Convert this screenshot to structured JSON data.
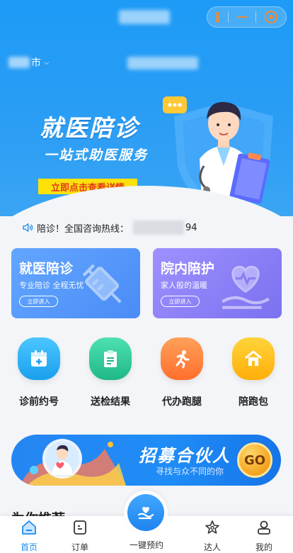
{
  "header": {
    "city_suffix": "市",
    "chevron": "⌵"
  },
  "banner": {
    "title": "就医陪诊",
    "subtitle": "一站式助医服务",
    "cta": "立即点击查看详情"
  },
  "notice": {
    "prefix": "陪诊！全国咨询热线：",
    "phone_tail": "94"
  },
  "cards": [
    {
      "title": "就医陪诊",
      "desc": "专业陪诊 全程无忧",
      "button": "立即进入"
    },
    {
      "title": "院内陪护",
      "desc": "家人般的温暖",
      "button": "立即进入"
    }
  ],
  "grid": [
    {
      "label": "诊前约号",
      "icon": "calendar-icon",
      "color": "#2bb3f3"
    },
    {
      "label": "送检结果",
      "icon": "clipboard-icon",
      "color": "#2fc99a"
    },
    {
      "label": "代办跑腿",
      "icon": "runner-icon",
      "color": "#ff8a3d"
    },
    {
      "label": "陪跑包",
      "icon": "house-icon",
      "color": "#ffc21a"
    }
  ],
  "partner": {
    "title": "招募合伙人",
    "subtitle": "寻找与众不同的你",
    "go": "GO"
  },
  "section_peek": "为你推荐",
  "tabs": [
    {
      "label": "首页",
      "icon": "home-icon",
      "active": true
    },
    {
      "label": "订单",
      "icon": "order-icon",
      "active": false
    },
    {
      "label": "一键预约",
      "icon": "heart-hand-icon",
      "active": false
    },
    {
      "label": "达人",
      "icon": "star-icon",
      "active": false
    },
    {
      "label": "我的",
      "icon": "user-icon",
      "active": false
    }
  ],
  "colors": {
    "primary": "#1e8cf0",
    "cta_yellow": "#ffe10a",
    "cta_text": "#e23b1b"
  }
}
